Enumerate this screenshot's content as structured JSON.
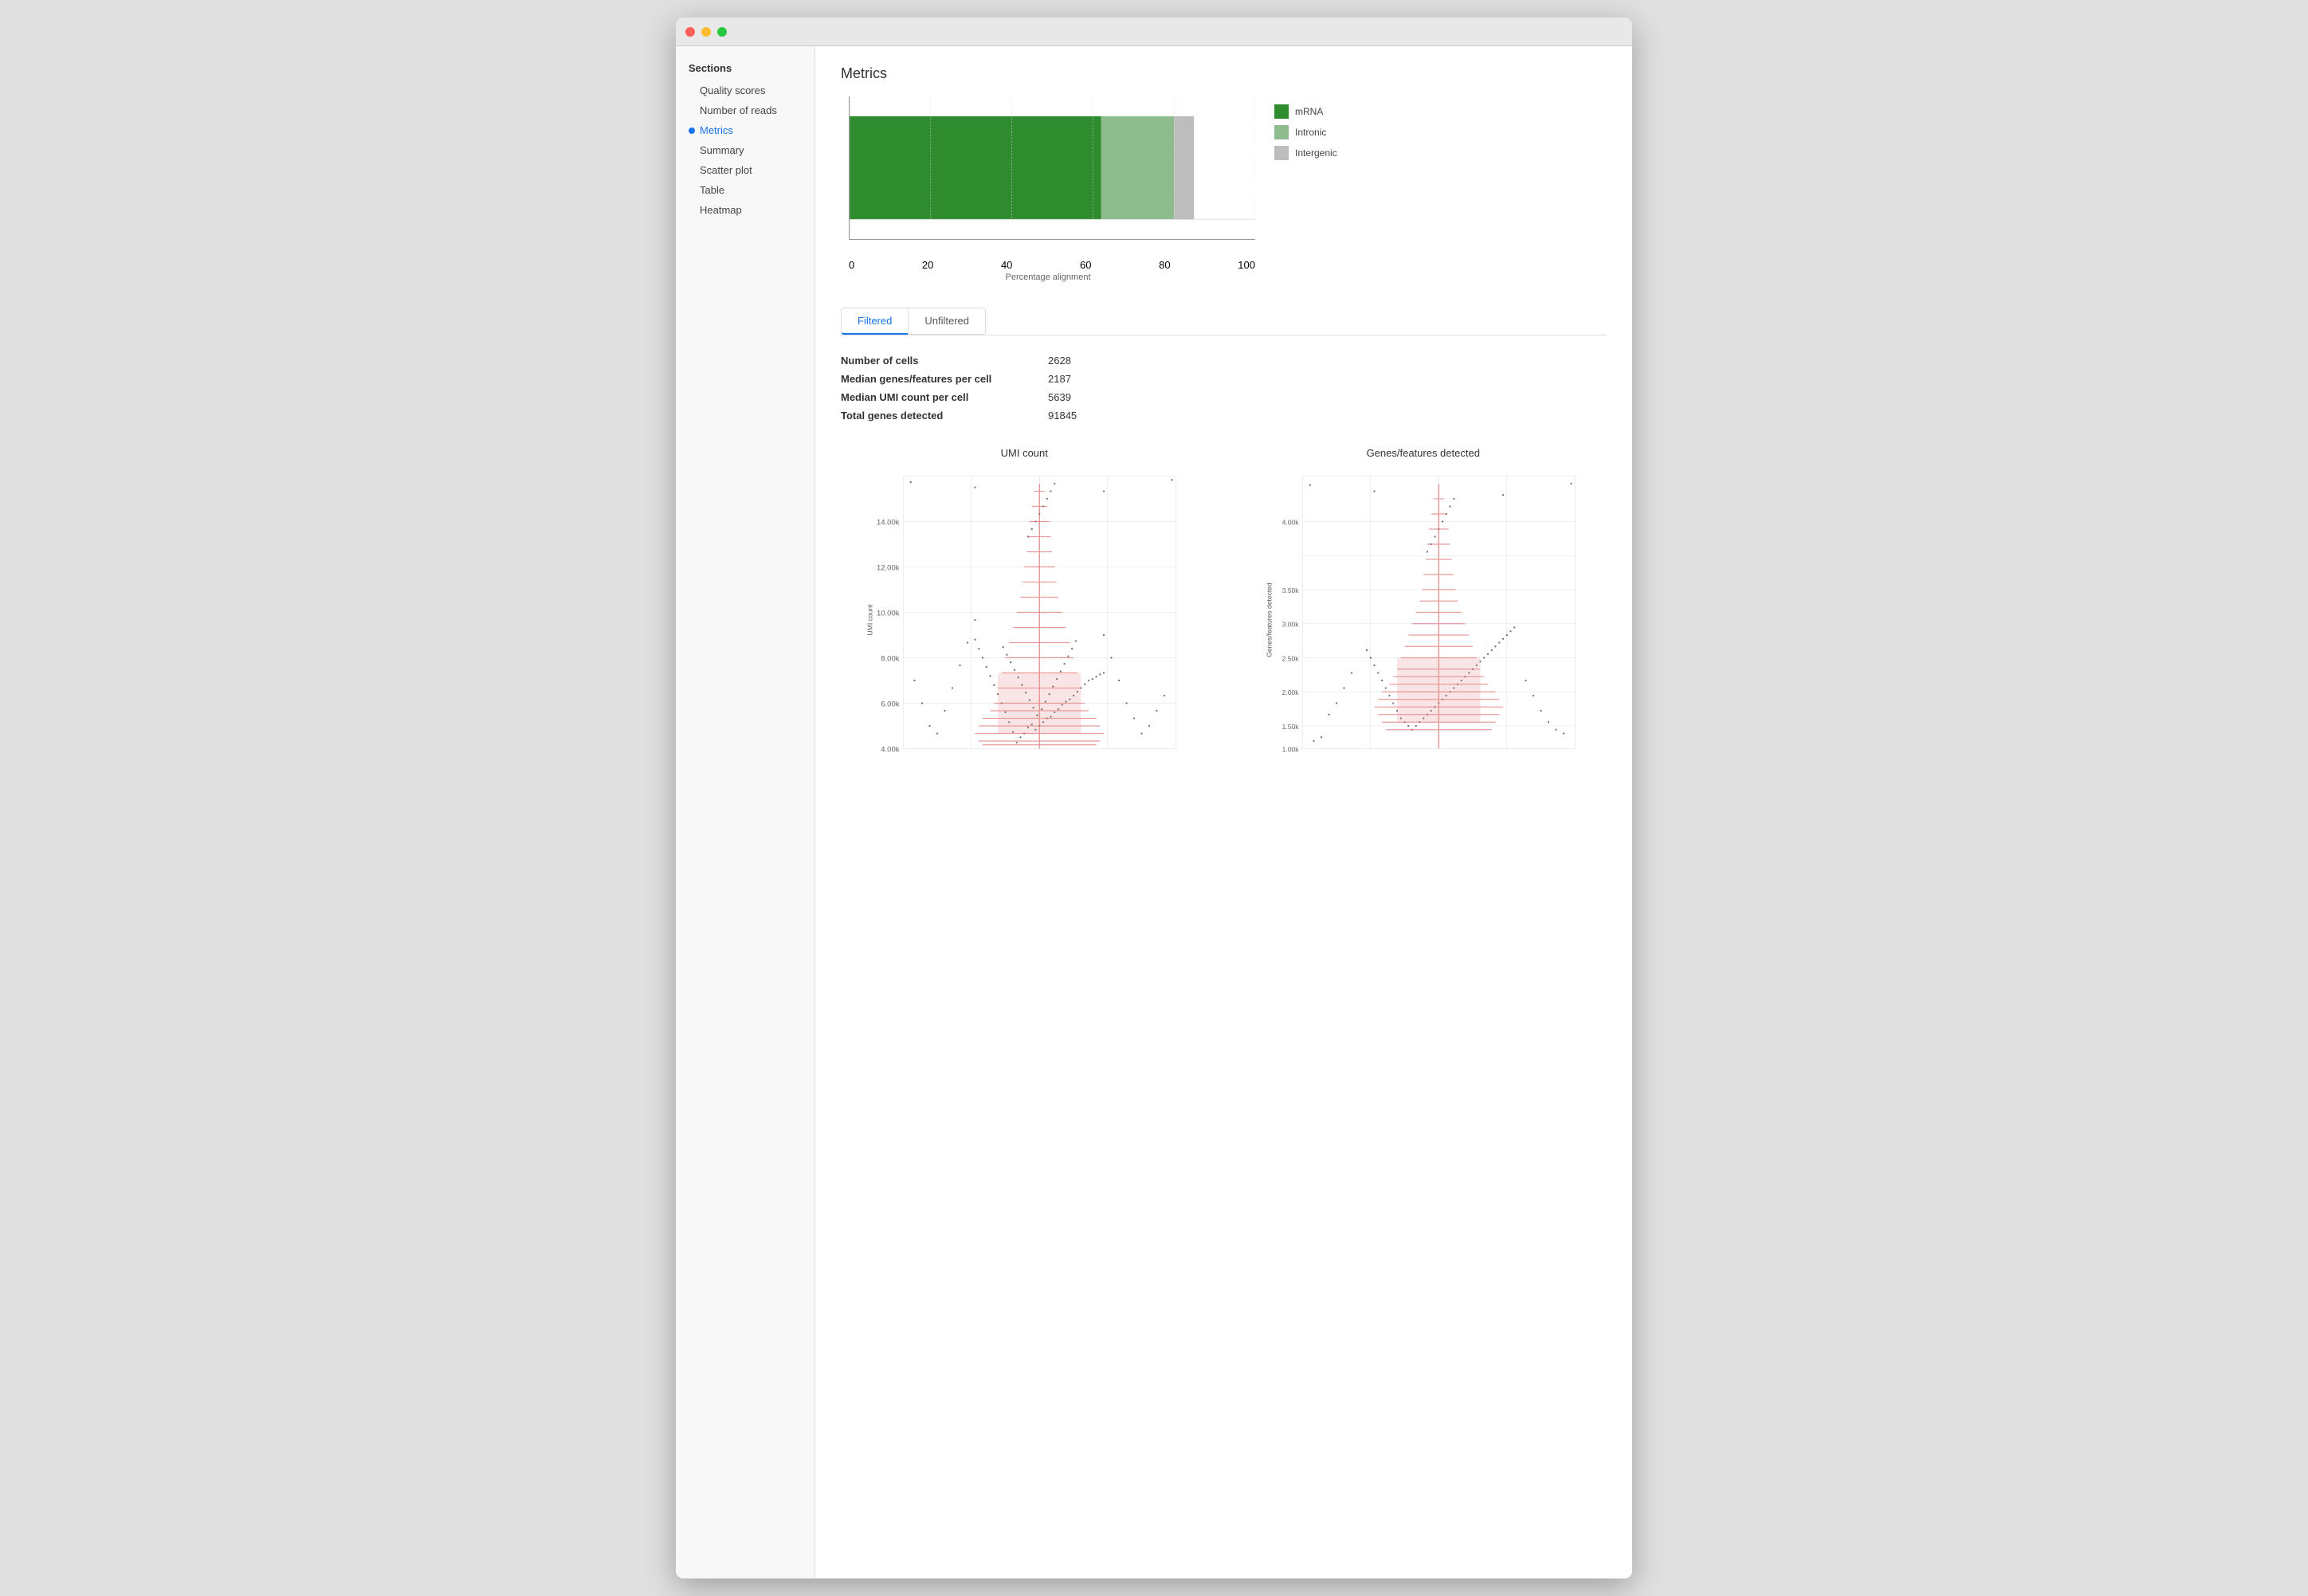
{
  "window": {
    "title": "Metrics"
  },
  "sidebar": {
    "header": "Sections",
    "items": [
      {
        "id": "quality-scores",
        "label": "Quality scores",
        "active": false
      },
      {
        "id": "number-of-reads",
        "label": "Number of reads",
        "active": false
      },
      {
        "id": "metrics",
        "label": "Metrics",
        "active": true
      },
      {
        "id": "summary",
        "label": "Summary",
        "active": false
      },
      {
        "id": "scatter-plot",
        "label": "Scatter plot",
        "active": false
      },
      {
        "id": "table",
        "label": "Table",
        "active": false
      },
      {
        "id": "heatmap",
        "label": "Heatmap",
        "active": false
      }
    ]
  },
  "main": {
    "section_title": "Metrics",
    "chart": {
      "bars": [
        {
          "label": "mRNA",
          "color": "#2e8b2e",
          "widthPercent": 62
        },
        {
          "label": "Intronic",
          "color": "#8fbc8f",
          "widthPercent": 18
        },
        {
          "label": "Intergenic",
          "color": "#bdbdbd",
          "widthPercent": 5
        }
      ],
      "x_axis": {
        "labels": [
          "0",
          "20",
          "40",
          "60",
          "80",
          "100"
        ],
        "title": "Percentage alignment"
      },
      "legend": [
        {
          "label": "mRNA",
          "color": "#2e8b2e"
        },
        {
          "label": "Intronic",
          "color": "#8fbc8f"
        },
        {
          "label": "Intergenic",
          "color": "#bdbdbd"
        }
      ]
    },
    "tabs": [
      {
        "label": "Filtered",
        "active": true
      },
      {
        "label": "Unfiltered",
        "active": false
      }
    ],
    "metrics": [
      {
        "label": "Number of cells",
        "value": "2628"
      },
      {
        "label": "Median genes/features per cell",
        "value": "2187"
      },
      {
        "label": "Median UMI count per cell",
        "value": "5639"
      },
      {
        "label": "Total genes detected",
        "value": "91845"
      }
    ],
    "plots": [
      {
        "id": "umi-count",
        "title": "UMI count",
        "y_axis_label": "UMI count",
        "y_ticks": [
          "4.00k",
          "6.00k",
          "8.00k",
          "10.00k",
          "12.00k",
          "14.00k"
        ]
      },
      {
        "id": "genes-features",
        "title": "Genes/features detected",
        "y_axis_label": "Genes/features detected",
        "y_ticks": [
          "1.00k",
          "1.50k",
          "2.00k",
          "2.50k",
          "3.00k",
          "3.50k",
          "4.00k"
        ]
      }
    ]
  }
}
